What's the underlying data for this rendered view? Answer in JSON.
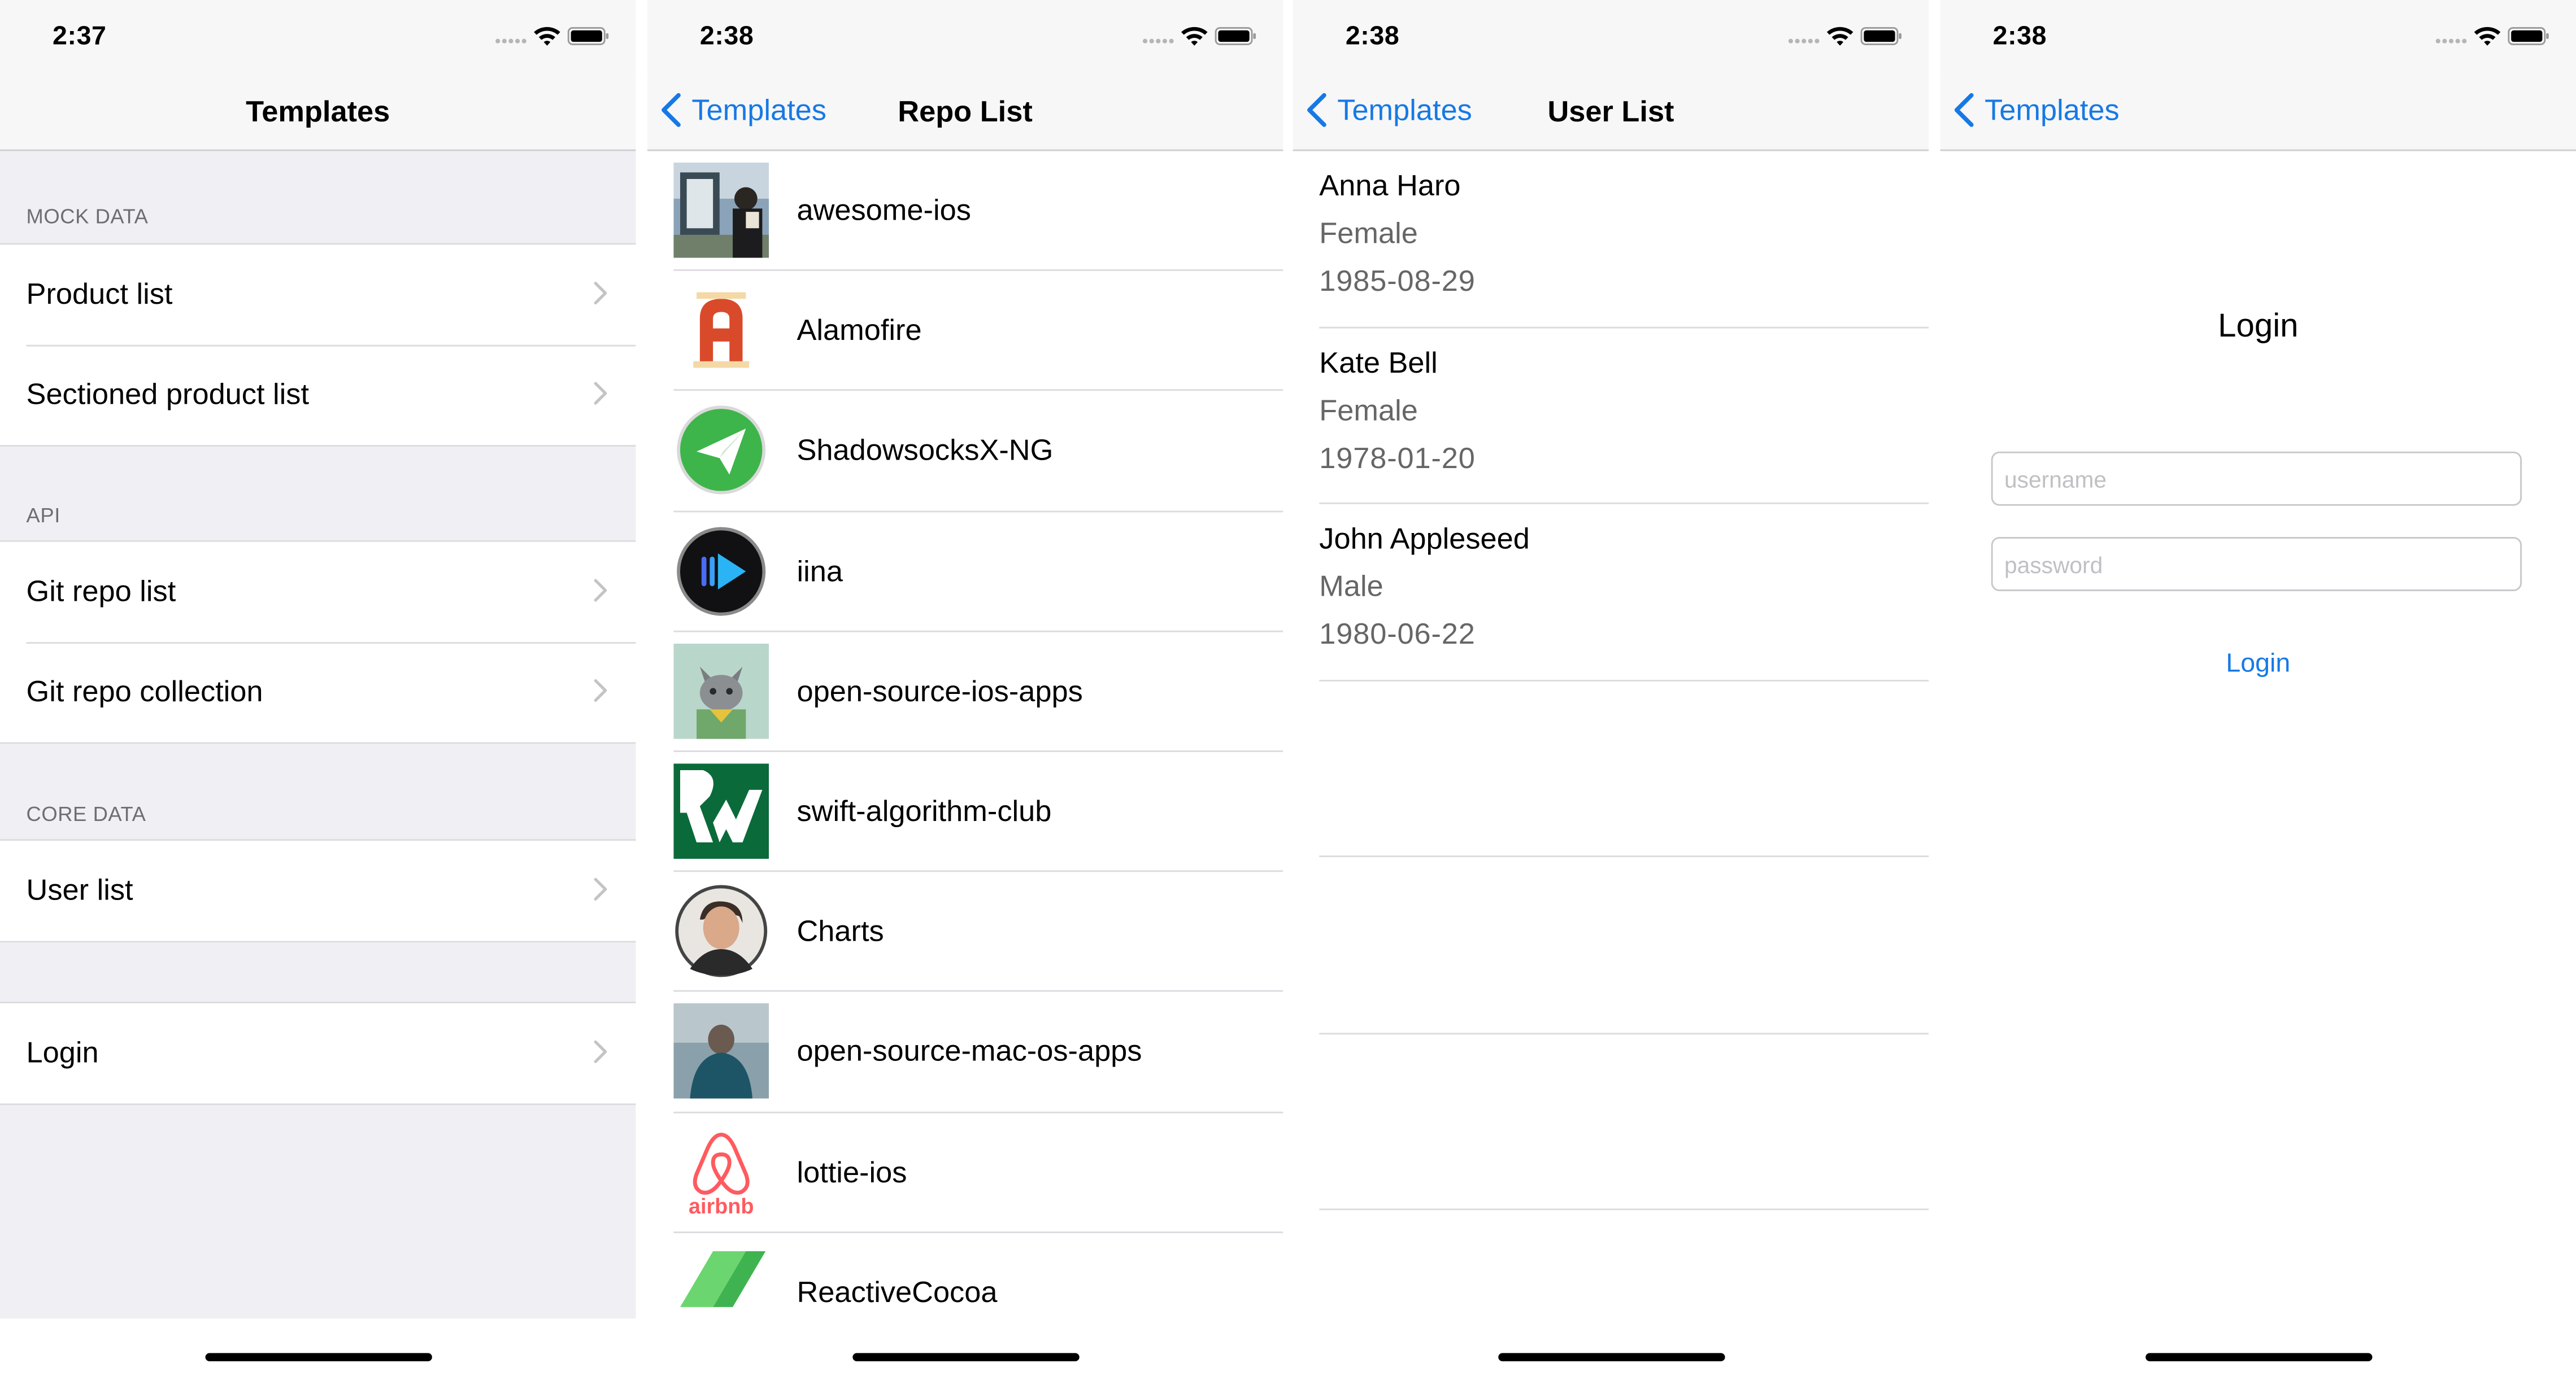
{
  "accent_color": "#1679e5",
  "screens": {
    "templates": {
      "time": "2:37",
      "title": "Templates",
      "sections": [
        {
          "header": "MOCK DATA",
          "items": [
            "Product list",
            "Sectioned product list"
          ]
        },
        {
          "header": "API",
          "items": [
            "Git repo list",
            "Git repo collection"
          ]
        },
        {
          "header": "CORE DATA",
          "items": [
            "User list"
          ]
        },
        {
          "header": "",
          "items": [
            "Login"
          ]
        }
      ]
    },
    "repo_list": {
      "time": "2:38",
      "back": "Templates",
      "title": "Repo List",
      "repos": [
        {
          "name": "awesome-ios",
          "icon": "photo-avatar-icon"
        },
        {
          "name": "Alamofire",
          "icon": "alamofire-logo-icon"
        },
        {
          "name": "ShadowsocksX-NG",
          "icon": "paper-plane-icon"
        },
        {
          "name": "iina",
          "icon": "iina-play-icon"
        },
        {
          "name": "open-source-ios-apps",
          "icon": "cat-avatar-icon"
        },
        {
          "name": "swift-algorithm-club",
          "icon": "raywenderlich-logo-icon"
        },
        {
          "name": "Charts",
          "icon": "person-avatar-icon"
        },
        {
          "name": "open-source-mac-os-apps",
          "icon": "hooded-person-icon"
        },
        {
          "name": "lottie-ios",
          "icon": "airbnb-logo-icon"
        },
        {
          "name": "ReactiveCocoa",
          "icon": "reactivecocoa-logo-icon"
        }
      ],
      "airbnb_wordmark": "airbnb"
    },
    "user_list": {
      "time": "2:38",
      "back": "Templates",
      "title": "User List",
      "users": [
        {
          "name": "Anna Haro",
          "gender": "Female",
          "dob": "1985-08-29"
        },
        {
          "name": "Kate Bell",
          "gender": "Female",
          "dob": "1978-01-20"
        },
        {
          "name": "John Appleseed",
          "gender": "Male",
          "dob": "1980-06-22"
        }
      ]
    },
    "login": {
      "time": "2:38",
      "back": "Templates",
      "title": "Login",
      "username_placeholder": "username",
      "password_placeholder": "password",
      "button": "Login"
    }
  }
}
